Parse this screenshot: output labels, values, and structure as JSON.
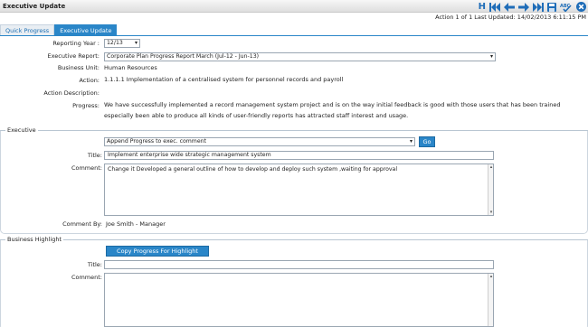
{
  "window": {
    "title": "Executive Update"
  },
  "toolbar": {
    "items": [
      {
        "name": "help-button",
        "label": "H"
      },
      {
        "name": "first-record-icon"
      },
      {
        "name": "previous-record-icon"
      },
      {
        "name": "next-record-icon"
      },
      {
        "name": "last-record-icon"
      },
      {
        "name": "save-icon"
      },
      {
        "name": "spell-check-icon",
        "label": "ABC"
      },
      {
        "name": "close-icon"
      }
    ]
  },
  "status": {
    "text": "Action 1 of 1 Last Updated: 14/02/2013 6:11:15 PM"
  },
  "tabs": [
    {
      "label": "Quick Progress",
      "active": false
    },
    {
      "label": "Executive Update",
      "active": true
    }
  ],
  "form": {
    "reporting_year": {
      "label": "Reporting Year :",
      "value": "12/13"
    },
    "executive_report": {
      "label": "Executive Report:",
      "value": "Corporate Plan Progress Report March (Jul-12 - Jun-13)"
    },
    "business_unit": {
      "label": "Business Unit:",
      "value": "Human Resources"
    },
    "action": {
      "label": "Action:",
      "value": "1.1.1.1 Implementation of a centralised system for personnel records and payroll"
    },
    "action_description": {
      "label": "Action Description:",
      "value": ""
    },
    "progress": {
      "label": "Progress:",
      "value": "We have successfully implemented a record management system project and is on the way initial feedback is good with those users that has been trained especially been able to produce all kinds of user-friendly reports has attracted staff interest and usage."
    }
  },
  "executive": {
    "legend": "Executive",
    "append_select": "Append Progress to exec. comment",
    "go_label": "Go",
    "title_label": "Title:",
    "title_value": "Implement enterprise wide strategic management system",
    "comment_label": "Comment:",
    "comment_value": "Change it Developed a general outline of how to develop and deploy such system ,waiting for approval",
    "comment_by_label": "Comment By:",
    "comment_by_value": "Joe Smith - Manager"
  },
  "business_highlight": {
    "legend": "Business Highlight",
    "copy_button": "Copy Progress For Highlight",
    "title_label": "Title:",
    "title_value": "",
    "comment_label": "Comment:",
    "comment_value": ""
  },
  "colors": {
    "accent": "#2a86c8",
    "icon_blue": "#1f6db8"
  }
}
